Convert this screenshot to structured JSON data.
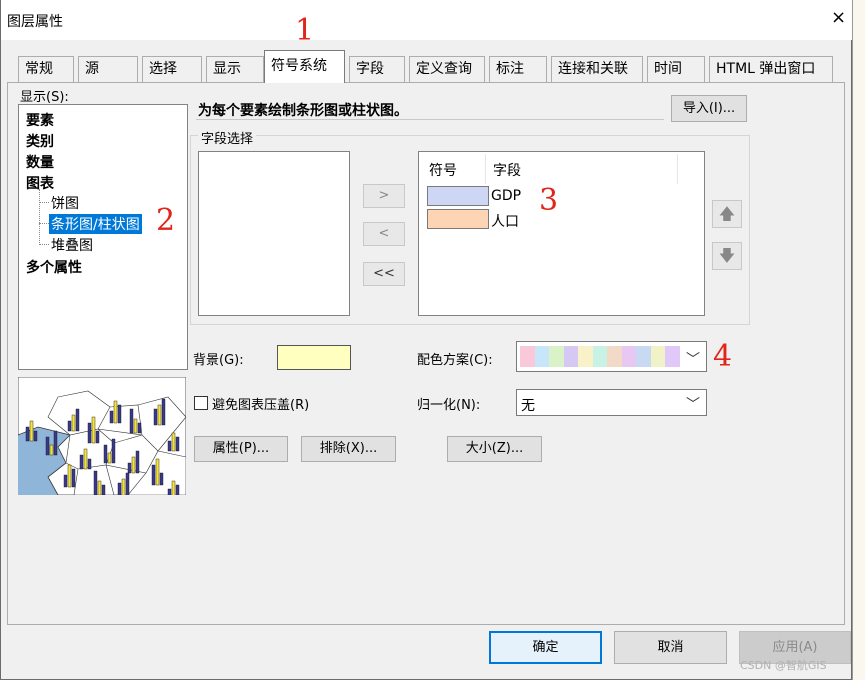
{
  "window": {
    "title": "图层属性",
    "close_glyph": "×"
  },
  "tabs": [
    {
      "label": "常规"
    },
    {
      "label": "源"
    },
    {
      "label": "选择"
    },
    {
      "label": "显示"
    },
    {
      "label": "符号系统",
      "active": true
    },
    {
      "label": "字段"
    },
    {
      "label": "定义查询"
    },
    {
      "label": "标注"
    },
    {
      "label": "连接和关联"
    },
    {
      "label": "时间"
    },
    {
      "label": "HTML 弹出窗口"
    }
  ],
  "annotations": {
    "n1": "1",
    "n2": "2",
    "n3": "3",
    "n4": "4"
  },
  "show": {
    "label": "显示(S):",
    "items": {
      "features": "要素",
      "categories": "类别",
      "quantities": "数量",
      "charts": "图表",
      "pie": "饼图",
      "bar": "条形图/柱状图",
      "stacked": "堆叠图",
      "multiple": "多个属性"
    }
  },
  "description": "为每个要素绘制条形图或柱状图。",
  "import_button": "导入(I)...",
  "field_selection": {
    "legend": "字段选择",
    "add_glyph": ">",
    "remove_glyph": "<",
    "remove_all_glyph": "<<",
    "col_symbol": "符号",
    "col_field": "字段",
    "rows": [
      {
        "field": "GDP",
        "color": "#cdd6f4"
      },
      {
        "field": "人口",
        "color": "#fdd5b4"
      }
    ],
    "up_glyph": "🡅",
    "down_glyph": "🡇"
  },
  "background": {
    "label": "背景(G):",
    "color": "#ffffc0"
  },
  "color_scheme": {
    "label": "配色方案(C):",
    "swatches": [
      "#f9c8d9",
      "#c8e6f9",
      "#d9f2c8",
      "#d5c8f2",
      "#f9f2c8",
      "#c8f2e6",
      "#f2d9c8",
      "#e6c8f2",
      "#c8d9f2",
      "#f2f2c8",
      "#e0c8f9"
    ]
  },
  "avoid_overlap": {
    "label": "避免图表压盖(R)",
    "checked": false
  },
  "normalization": {
    "label": "归一化(N):",
    "value": "无"
  },
  "buttons": {
    "properties": "属性(P)...",
    "exclusion": "排除(X)...",
    "size": "大小(Z)...",
    "ok": "确定",
    "cancel": "取消",
    "apply": "应用(A)"
  },
  "watermark": "CSDN @智航GIS",
  "colors": {
    "selection": "#0078d7",
    "annotation_red": "#e0261b"
  }
}
